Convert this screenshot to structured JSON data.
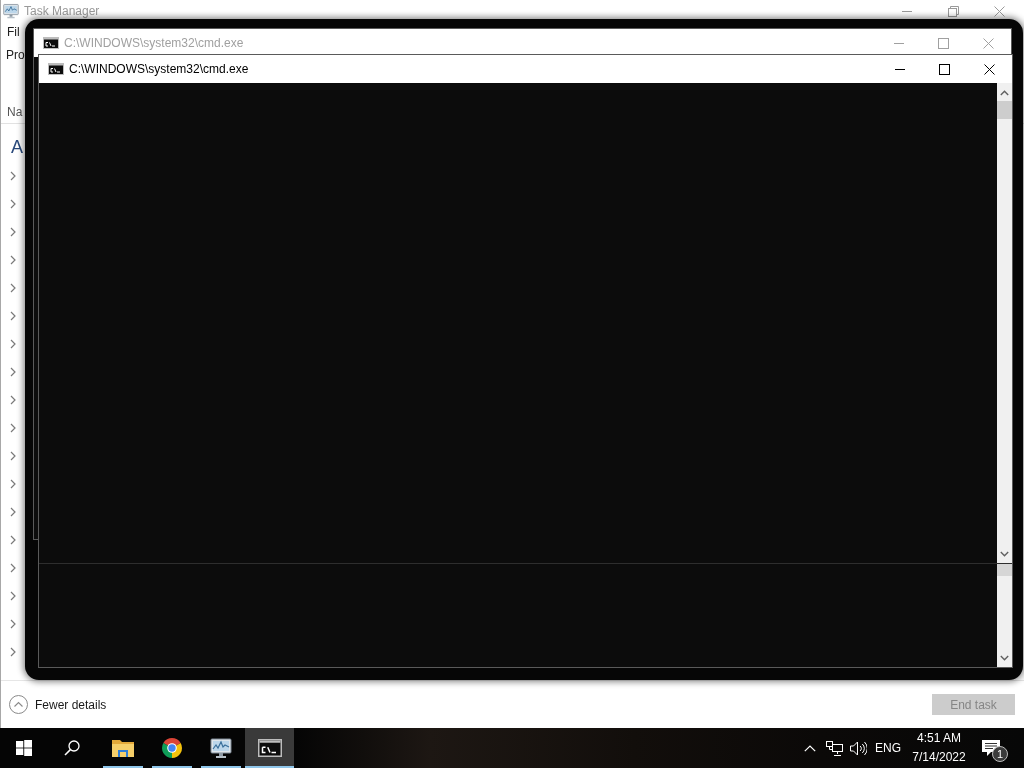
{
  "task_manager": {
    "title": "Task Manager",
    "active": false,
    "menu": [
      "Fil"
    ],
    "tabs": [
      "Pro"
    ],
    "column_header": "Na",
    "group_heading": "A",
    "rows": [
      {
        "expanded": false
      },
      {
        "expanded": false
      },
      {
        "expanded": false
      },
      {
        "expanded": false
      },
      {
        "expanded": false
      },
      {
        "expanded": false
      },
      {
        "expanded": false
      },
      {
        "expanded": false
      },
      {
        "expanded": false
      },
      {
        "expanded": false
      },
      {
        "expanded": false
      },
      {
        "expanded": false
      },
      {
        "expanded": false
      },
      {
        "expanded": false
      },
      {
        "expanded": false
      },
      {
        "expanded": false
      },
      {
        "expanded": false
      },
      {
        "expanded": false
      }
    ],
    "footer": {
      "toggle": "Fewer details",
      "end_task": {
        "label": "End task",
        "disabled": true
      }
    }
  },
  "console_windows": [
    {
      "title": "C:\\WINDOWS\\system32\\cmd.exe",
      "active": false
    },
    {
      "title": "C:\\WINDOWS\\system32\\cmd.exe",
      "active": true
    }
  ],
  "taskbar": {
    "apps": [
      {
        "kind": "file-explorer",
        "running": true,
        "selected": false
      },
      {
        "kind": "browser",
        "running": true,
        "selected": false
      },
      {
        "kind": "task-manager",
        "running": true,
        "selected": false
      },
      {
        "kind": "console",
        "running": true,
        "selected": true
      }
    ],
    "tray": {
      "language": "ENG",
      "time": "4:51 AM",
      "date": "7/14/2022",
      "notifications": "1"
    }
  }
}
